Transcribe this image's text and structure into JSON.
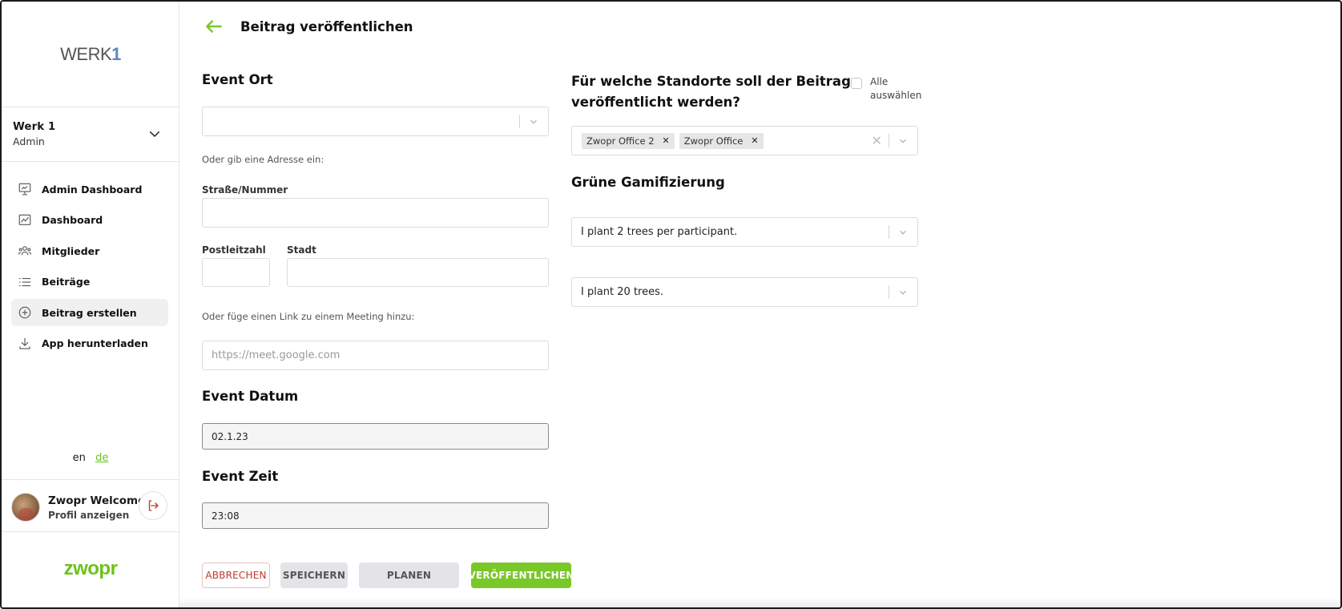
{
  "sidebar": {
    "brand": {
      "main": "WERK",
      "accent": "1"
    },
    "org": {
      "name": "Werk 1",
      "role": "Admin"
    },
    "items": [
      {
        "label": "Admin Dashboard",
        "icon": "presentation-icon"
      },
      {
        "label": "Dashboard",
        "icon": "chart-icon"
      },
      {
        "label": "Mitglieder",
        "icon": "users-icon"
      },
      {
        "label": "Beiträge",
        "icon": "list-icon"
      },
      {
        "label": "Beitrag erstellen",
        "icon": "plus-circle-icon",
        "active": true
      },
      {
        "label": "App herunterladen",
        "icon": "download-icon"
      }
    ],
    "lang": {
      "en": "en",
      "de": "de"
    },
    "profile": {
      "name": "Zwopr Welcome",
      "link": "Profil anzeigen"
    },
    "footer_logo": "zwopr"
  },
  "header": {
    "title": "Beitrag veröffentlichen"
  },
  "form": {
    "event_ort": {
      "title": "Event Ort",
      "select_value": "",
      "address_hint": "Oder gib eine Adresse ein:",
      "street_label": "Straße/Nummer",
      "street_value": "",
      "zip_label": "Postleitzahl",
      "zip_value": "",
      "city_label": "Stadt",
      "city_value": "",
      "link_hint": "Oder füge einen Link zu einem Meeting hinzu:",
      "link_placeholder": "https://meet.google.com"
    },
    "event_datum": {
      "title": "Event Datum",
      "value": "02.1.23"
    },
    "event_zeit": {
      "title": "Event Zeit",
      "value": "23:08"
    },
    "standorte": {
      "title_line1": "Für welche Standorte soll der Beitrag",
      "title_line2": "veröffentlicht werden?",
      "select_all_line1": "Alle",
      "select_all_line2": "auswählen",
      "chips": [
        "Zwopr Office 2",
        "Zwopr Office"
      ]
    },
    "gamification": {
      "title": "Grüne Gamifizierung",
      "select1": "I plant 2 trees per participant.",
      "select2": "I plant 20 trees."
    },
    "buttons": {
      "cancel": "ABBRECHEN",
      "save": "SPEICHERN",
      "plan": "PLANEN",
      "publish": "VERÖFFENTLICHEN"
    }
  },
  "colors": {
    "accent_green": "#7ac72a",
    "danger_red": "#c0392b",
    "brand_blue": "#5b87c5"
  }
}
